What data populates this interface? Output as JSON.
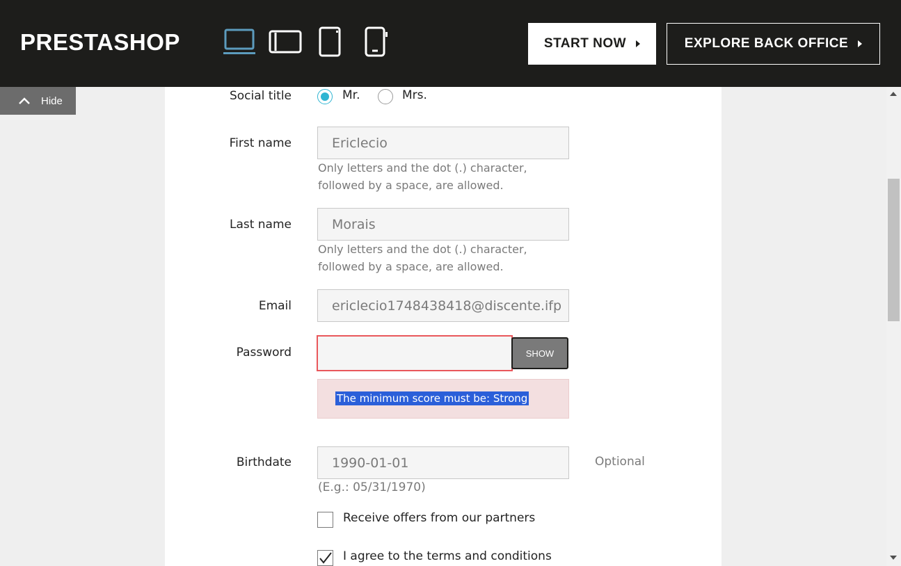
{
  "header": {
    "logo": "PRESTASHOP",
    "devices": [
      {
        "name": "laptop-icon",
        "active": true
      },
      {
        "name": "tablet-landscape-icon",
        "active": false
      },
      {
        "name": "tablet-portrait-icon",
        "active": false
      },
      {
        "name": "mobile-icon",
        "active": false
      }
    ],
    "start_label": "START NOW",
    "explore_label": "EXPLORE BACK OFFICE",
    "accent": "#5c9bbd"
  },
  "sidebar": {
    "hide_label": "Hide"
  },
  "form": {
    "social_title": {
      "label": "Social title",
      "options": [
        "Mr.",
        "Mrs."
      ],
      "selected": "Mr."
    },
    "first_name": {
      "label": "First name",
      "value": "Ericlecio",
      "help_line1": "Only letters and the dot (.) character,",
      "help_line2": "followed by a space, are allowed."
    },
    "last_name": {
      "label": "Last name",
      "value": "Morais",
      "help_line1": "Only letters and the dot (.) character,",
      "help_line2": "followed by a space, are allowed."
    },
    "email": {
      "label": "Email",
      "value": "ericlecio1748438418@discente.ifp"
    },
    "password": {
      "label": "Password",
      "value": "",
      "show_label": "SHOW",
      "error": "The minimum score must be: Strong"
    },
    "birthdate": {
      "label": "Birthdate",
      "value": "1990-01-01",
      "optional": "Optional",
      "hint": "(E.g.: 05/31/1970)"
    },
    "partner_offers": {
      "label": "Receive offers from our partners",
      "checked": false
    },
    "terms": {
      "label": "I agree to the terms and conditions",
      "checked": true
    }
  }
}
